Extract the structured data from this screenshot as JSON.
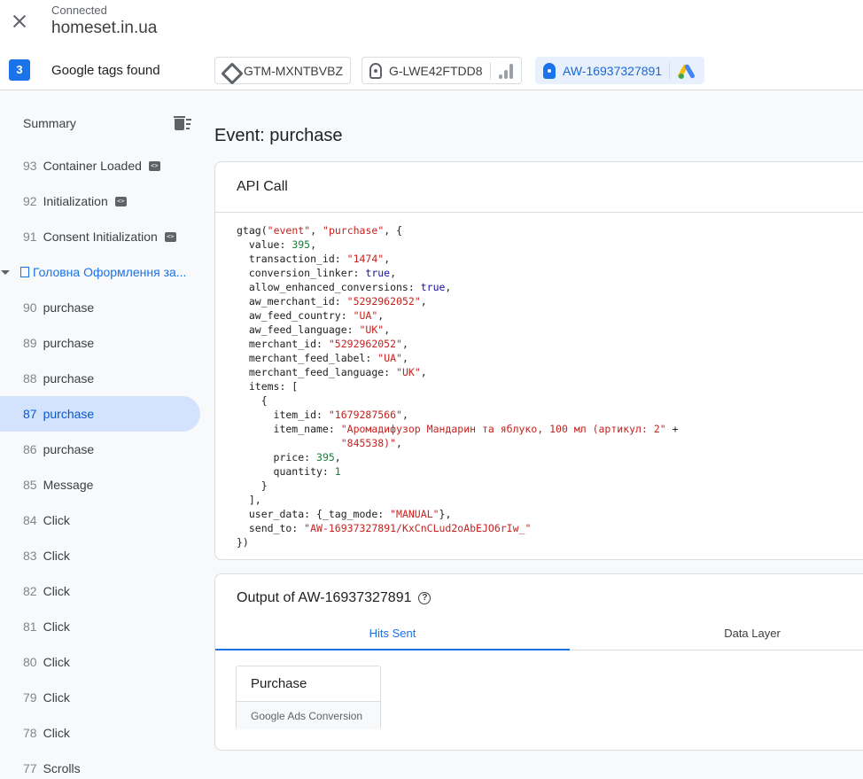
{
  "header": {
    "status": "Connected",
    "domain": "homeset.in.ua",
    "tag_count": "3",
    "tags_found_label": "Google tags found",
    "tags": [
      {
        "id": "GTM-MXNTBVBZ",
        "icon": "gtm-icon"
      },
      {
        "id": "G-LWE42FTDD8",
        "icon": "google-tag-icon",
        "extra_icon": "analytics-icon"
      },
      {
        "id": "AW-16937327891",
        "icon": "google-tag-icon",
        "extra_icon": "google-ads-icon",
        "active": true
      }
    ]
  },
  "sidebar": {
    "summary_label": "Summary",
    "events": [
      {
        "num": "93",
        "label": "Container Loaded",
        "code_icon": true
      },
      {
        "num": "92",
        "label": "Initialization",
        "code_icon": true
      },
      {
        "num": "91",
        "label": "Consent Initialization",
        "code_icon": true
      },
      {
        "page": true,
        "label": "Головна Оформлення за..."
      },
      {
        "num": "90",
        "label": "purchase"
      },
      {
        "num": "89",
        "label": "purchase"
      },
      {
        "num": "88",
        "label": "purchase"
      },
      {
        "num": "87",
        "label": "purchase",
        "selected": true
      },
      {
        "num": "86",
        "label": "purchase"
      },
      {
        "num": "85",
        "label": "Message"
      },
      {
        "num": "84",
        "label": "Click"
      },
      {
        "num": "83",
        "label": "Click"
      },
      {
        "num": "82",
        "label": "Click"
      },
      {
        "num": "81",
        "label": "Click"
      },
      {
        "num": "80",
        "label": "Click"
      },
      {
        "num": "79",
        "label": "Click"
      },
      {
        "num": "78",
        "label": "Click"
      },
      {
        "num": "77",
        "label": "Scrolls"
      }
    ]
  },
  "main": {
    "event_title": "Event: purchase",
    "api_call_title": "API Call",
    "code": {
      "fn": "gtag",
      "event": "event",
      "name": "purchase",
      "value": "395",
      "transaction_id": "1474",
      "conversion_linker": "true",
      "allow_enhanced_conversions": "true",
      "aw_merchant_id": "5292962052",
      "aw_feed_country": "UA",
      "aw_feed_language": "UK",
      "merchant_id": "5292962052",
      "merchant_feed_label": "UA",
      "merchant_feed_language": "UK",
      "item_id": "1679287566",
      "item_name_1": "Аромадифузор Мандарин та яблуко, 100 мл (артикул: 2",
      "item_name_2": "845538)",
      "price": "395",
      "quantity": "1",
      "tag_mode": "MANUAL",
      "send_to": "AW-16937327891/KxCnCLud2oAbEJO6rIw_"
    },
    "output_title": "Output of AW-16937327891",
    "tabs": [
      "Hits Sent",
      "Data Layer"
    ],
    "hit": {
      "name": "Purchase",
      "type": "Google Ads Conversion"
    }
  }
}
